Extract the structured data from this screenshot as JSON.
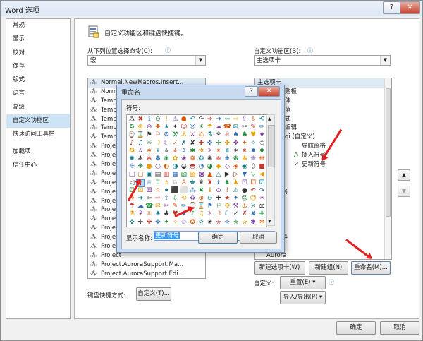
{
  "window": {
    "title": "Word 选项",
    "help_label": "?",
    "close_label": "✕"
  },
  "sidebar": {
    "items": [
      "常规",
      "显示",
      "校对",
      "保存",
      "版式",
      "语言",
      "高级",
      "自定义功能区",
      "快速访问工具栏",
      "加载项",
      "信任中心"
    ],
    "selected_index": 7
  },
  "main": {
    "header": "自定义功能区和键盘快捷键。",
    "left_label": "从下列位置选择命令(C):",
    "left_combo": "宏",
    "right_label": "自定义功能区(B):",
    "right_combo": "主选项卡",
    "left_list": [
      "Normal.NewMacros.Insert...",
      "Normal.NewMacros.Save...",
      "Temp",
      "Temp",
      "Temp",
      "Temp",
      "Temp",
      "Project",
      "Project",
      "Project",
      "Project",
      "Project",
      "Project",
      "Project",
      "Project",
      "Project",
      "Project",
      "Project",
      "Project",
      "Project",
      "Project.AuroraSupport.Ma...",
      "Project.AuroraSupport.Edi...",
      "Project.AuroraSupport.Edi..."
    ],
    "right_list": [
      {
        "text": "主选项卡",
        "indent": 0
      },
      {
        "text": "贴板",
        "indent": 3
      },
      {
        "text": "体",
        "indent": 3
      },
      {
        "text": "落",
        "indent": 3
      },
      {
        "text": "式",
        "indent": 3
      },
      {
        "text": "编辑",
        "indent": 3
      },
      {
        "text": "qi (自定义)",
        "indent": 3
      },
      {
        "text": "导航窗格",
        "indent": 4
      },
      {
        "text": "插入符号",
        "indent": 4
      },
      {
        "text": "更新符号",
        "indent": 4
      },
      {
        "text": "",
        "indent": 0
      },
      {
        "text": "",
        "indent": 0
      },
      {
        "text": "布局",
        "indent": 2
      },
      {
        "text": "",
        "indent": 0
      },
      {
        "text": "",
        "indent": 0
      },
      {
        "text": "",
        "indent": 0
      },
      {
        "text": "",
        "indent": 0
      },
      {
        "text": "工具",
        "indent": 2
      },
      {
        "text": "",
        "indent": 0
      },
      {
        "text": "Aurora",
        "indent": 1
      }
    ],
    "up_label": "▲",
    "down_label": "▼",
    "new_tab_button": "新建选项卡(W)",
    "new_group_button": "新建组(N)",
    "rename_button": "重命名(M)...",
    "customize_label": "自定义:",
    "reset_button": "重置(E) ▾",
    "import_export_button": "导入/导出(P) ▾",
    "keyboard_label": "键盘快捷方式:",
    "keyboard_button": "自定义(T)..."
  },
  "footer": {
    "ok_button": "确定",
    "cancel_button": "取消"
  },
  "rename_dialog": {
    "title": "重命名",
    "help_label": "?",
    "symbol_label": "符号:",
    "display_name_label": "显示名称:",
    "display_name_value": "更新符号",
    "ok_button": "确定",
    "cancel_button": "取消",
    "selected_symbol_row": 8,
    "selected_symbol_col": 1
  }
}
